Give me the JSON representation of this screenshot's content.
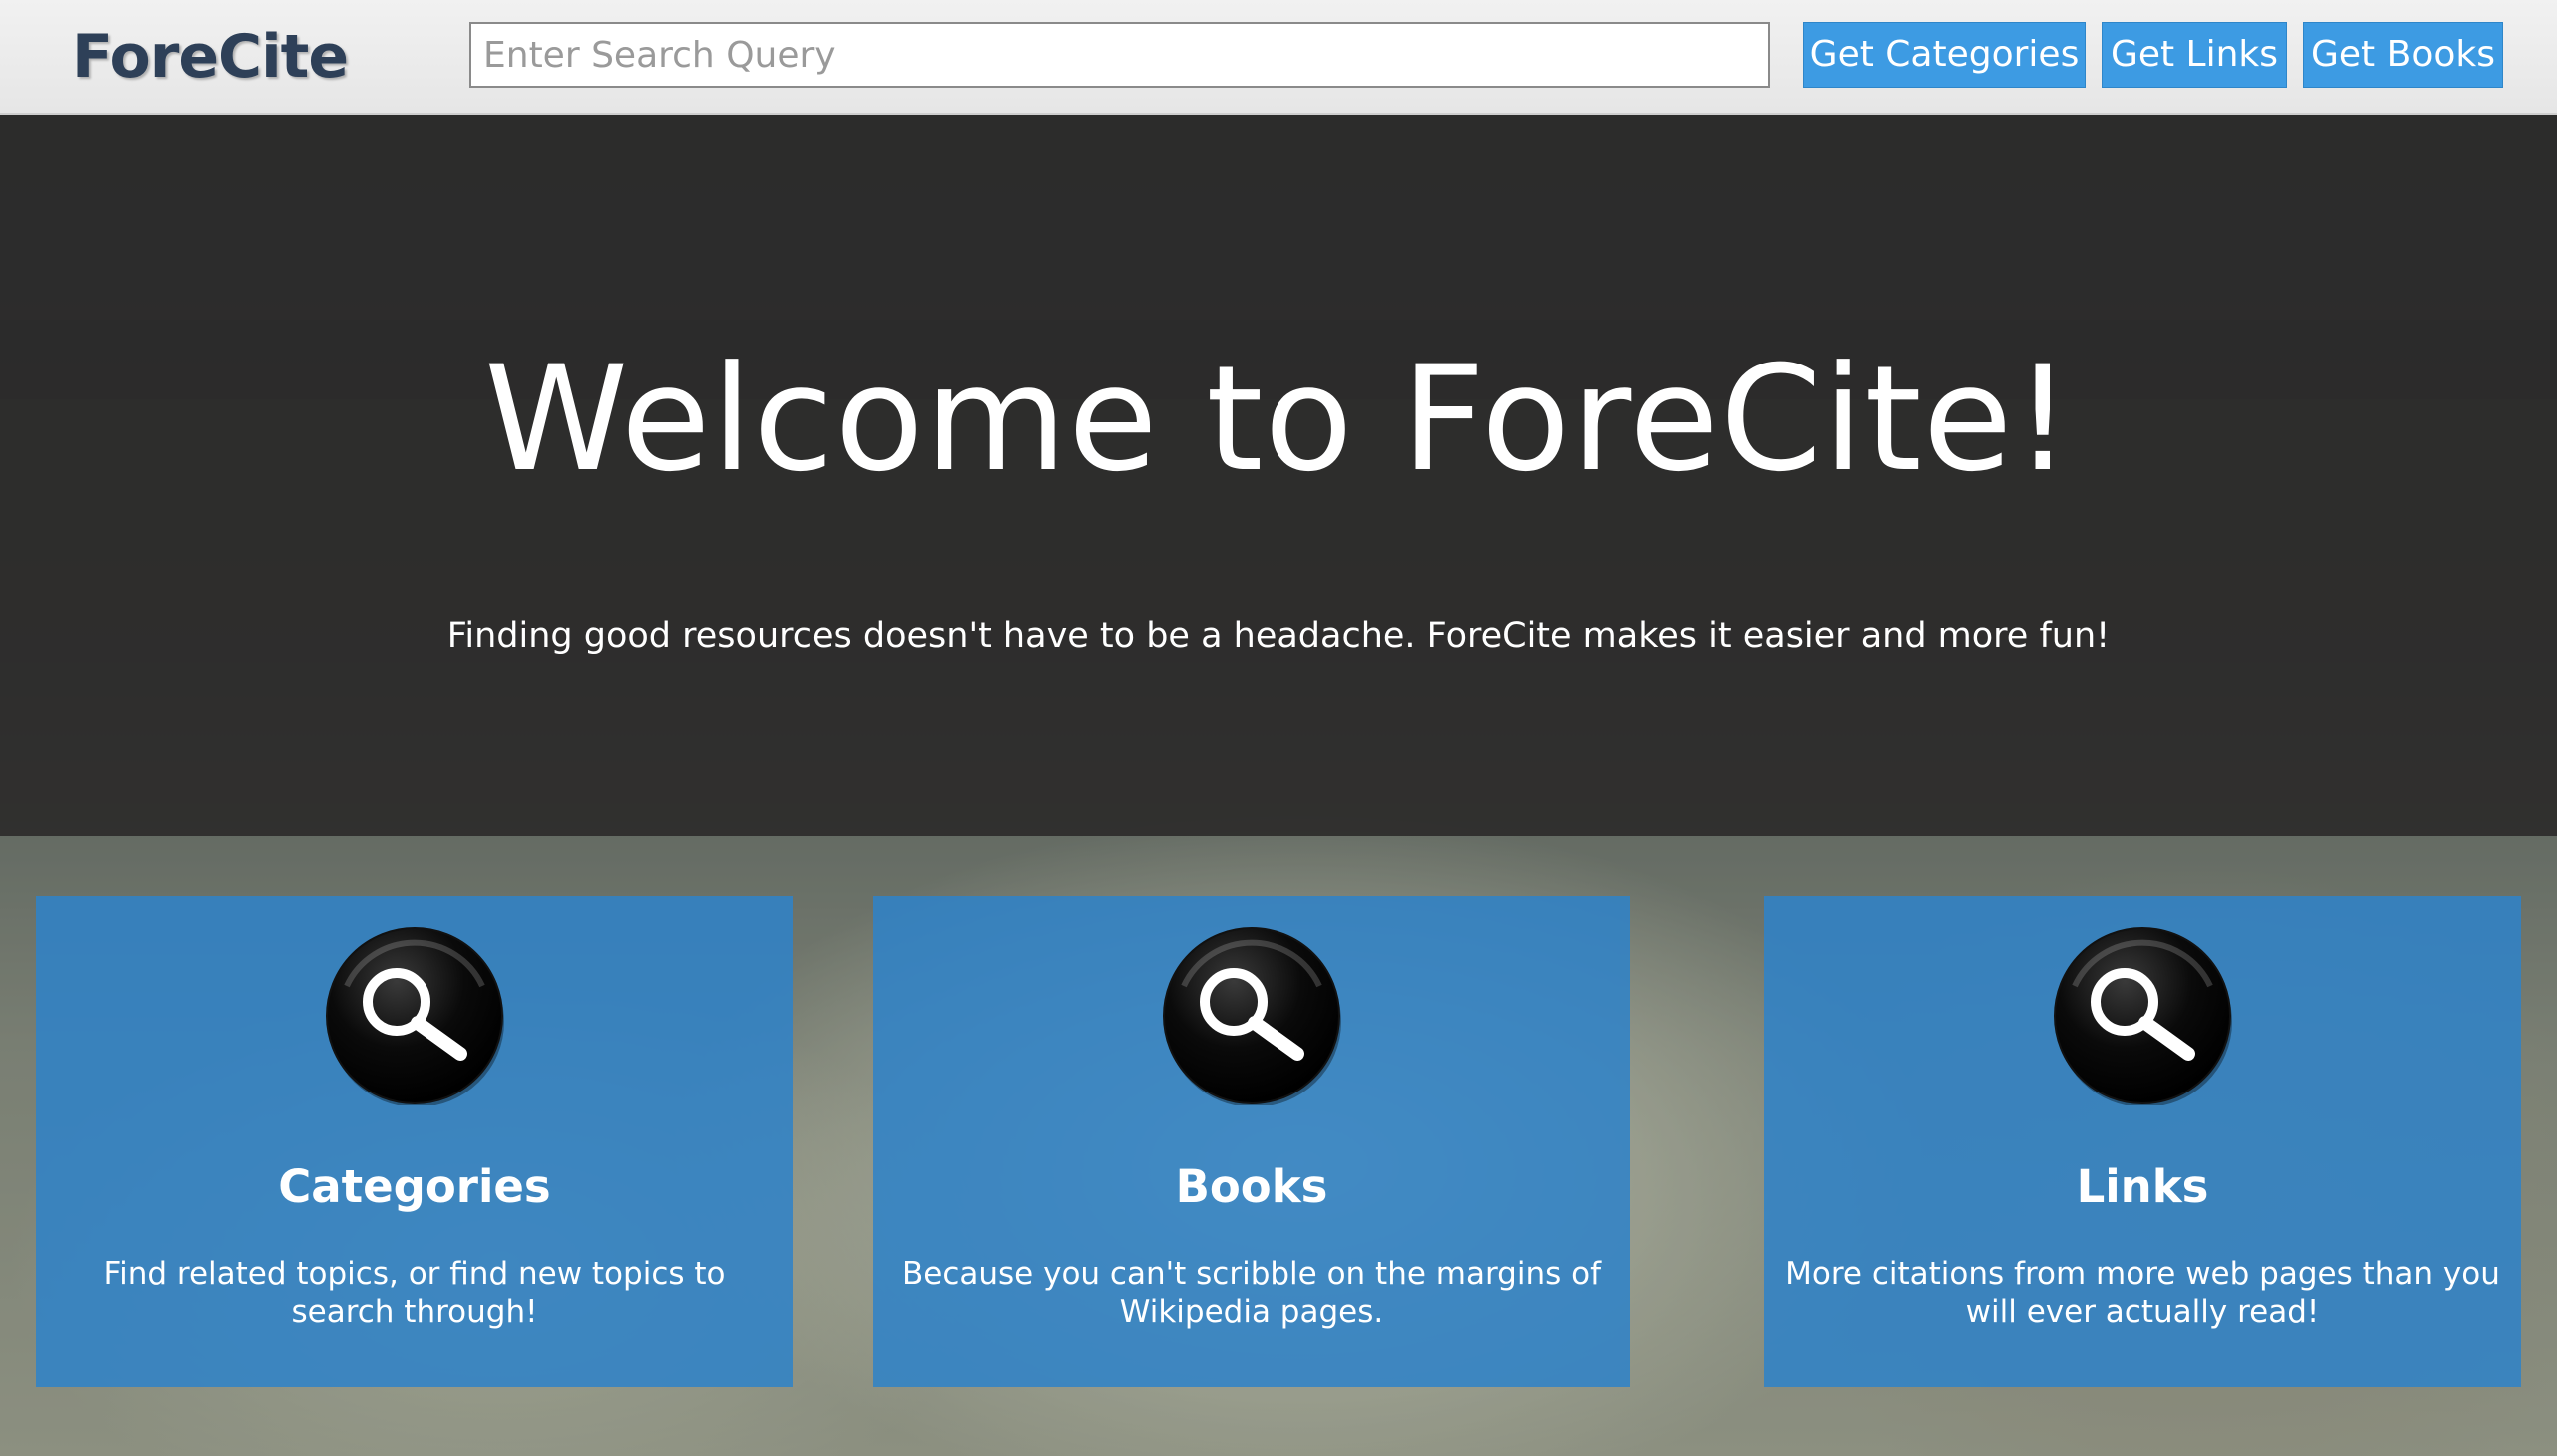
{
  "header": {
    "logo": "ForeCite",
    "search_placeholder": "Enter Search Query",
    "search_value": "",
    "buttons": {
      "categories": "Get Categories",
      "links": "Get Links",
      "books": "Get Books"
    }
  },
  "hero": {
    "title": "Welcome to ForeCite!",
    "subtitle": "Finding good resources doesn't have to be a headache. ForeCite makes it easier and more fun!"
  },
  "cards": [
    {
      "icon": "search-icon",
      "title": "Categories",
      "text": "Find related topics, or find new topics to search through!"
    },
    {
      "icon": "search-icon",
      "title": "Books",
      "text": "Because you can't scribble on the margins of Wikipedia pages."
    },
    {
      "icon": "search-icon",
      "title": "Links",
      "text": "More citations from more web pages than you will ever actually read!"
    }
  ],
  "colors": {
    "accent": "#3d9be3",
    "card": "#2e82c8",
    "logo": "#2e4058",
    "hero_overlay": "#282828"
  }
}
